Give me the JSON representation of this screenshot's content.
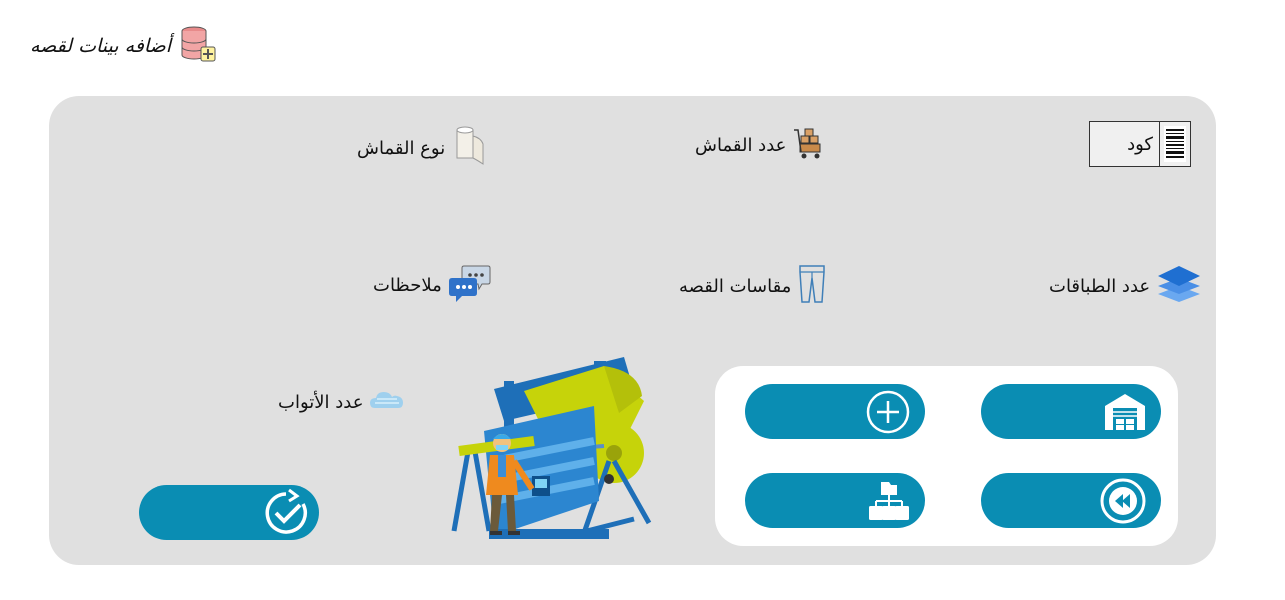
{
  "page": {
    "title": "أضافه بينات لقصه"
  },
  "fields": {
    "code": "كود",
    "fabric_count": "عدد القماش",
    "fabric_type": "نوع القماش",
    "layers_count": "عدد الطباقات",
    "cut_sizes": "مقاسات القصه",
    "notes": "ملاحظات",
    "pieces_count": "عدد الأتواب"
  },
  "colors": {
    "button": "#0a8db3",
    "panel": "#e0e0e0",
    "inner_panel": "#ffffff"
  },
  "icons": {
    "title": "database-add-icon",
    "code": "barcode-ticket-icon",
    "fabric_count": "cart-boxes-icon",
    "fabric_type": "fabric-roll-icon",
    "layers_count": "layers-icon",
    "cut_sizes": "trousers-icon",
    "notes": "chat-bubbles-icon",
    "pieces_count": "cloud-fabric-icon",
    "warehouse_button": "warehouse-icon",
    "add_button": "plus-circle-icon",
    "back_button": "rewind-icon",
    "hierarchy_button": "hierarchy-icon",
    "confirm_button": "check-refresh-icon"
  }
}
